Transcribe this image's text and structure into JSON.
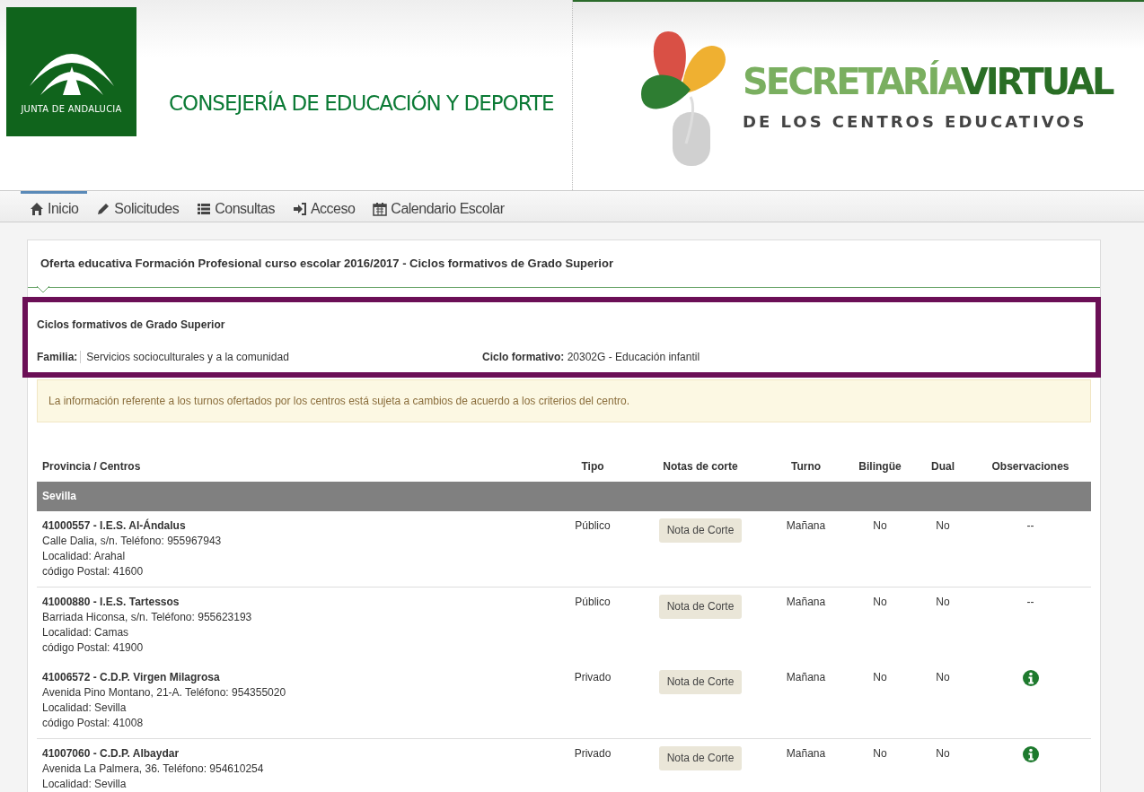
{
  "header": {
    "junta_logo_text": "JUNTA DE ANDALUCIA",
    "department": "CONSEJERÍA DE EDUCACIÓN Y DEPORTE",
    "brand_part_1": "SECRETARÍA",
    "brand_part_2": "VIRTUAL",
    "brand_subtitle": "DE LOS CENTROS EDUCATIVOS"
  },
  "nav": [
    {
      "label": "Inicio",
      "kind": "home",
      "selected": true
    },
    {
      "label": "Solicitudes",
      "kind": "pencil",
      "selected": false
    },
    {
      "label": "Consultas",
      "kind": "list",
      "selected": false
    },
    {
      "label": "Acceso",
      "kind": "login",
      "selected": false
    },
    {
      "label": "Calendario Escolar",
      "kind": "calendar",
      "selected": false
    }
  ],
  "panel_title": "Oferta educativa Formación Profesional curso escolar 2016/2017 - Ciclos formativos de Grado Superior",
  "selection": {
    "heading": "Ciclos formativos de Grado Superior",
    "familia_label": "Familia:",
    "familia_value": "Servicios socioculturales y a la comunidad",
    "ciclo_label": "Ciclo formativo:",
    "ciclo_value": "20302G - Educación infantil"
  },
  "notice": "La información referente a los turnos ofertados por los centros está sujeta a cambios de acuerdo a los criterios del centro.",
  "table": {
    "columns": [
      "Provincia / Centros",
      "Tipo",
      "Notas de corte",
      "Turno",
      "Bilingüe",
      "Dual",
      "Observaciones"
    ],
    "group": "Sevilla",
    "rows": [
      {
        "name": "41000557 - I.E.S. Al-Ándalus",
        "lines": [
          "Calle Dalia, s/n. Teléfono: 955967943",
          "Localidad: Arahal",
          "código Postal: 41600"
        ],
        "tipo": "Público",
        "button": "Nota de Corte",
        "turno": "Mañana",
        "bilingue": "No",
        "dual": "No",
        "kind": "text",
        "obs_text": "--"
      },
      {
        "name": "41000880 - I.E.S. Tartessos",
        "lines": [
          "Barriada Hiconsa, s/n. Teléfono: 955623193",
          "Localidad: Camas",
          "código Postal: 41900"
        ],
        "tipo": "Público",
        "button": "Nota de Corte",
        "turno": "Mañana",
        "bilingue": "No",
        "dual": "No",
        "kind": "text",
        "obs_text": "--"
      },
      {
        "name": "41006572 - C.D.P. Virgen Milagrosa",
        "lines": [
          "Avenida Pino Montano, 21-A. Teléfono: 954355020",
          "Localidad: Sevilla",
          "código Postal: 41008"
        ],
        "tipo": "Privado",
        "button": "Nota de Corte",
        "turno": "Mañana",
        "bilingue": "No",
        "dual": "No",
        "kind": "info"
      },
      {
        "name": "41007060 - C.D.P. Albaydar",
        "lines": [
          "Avenida La Palmera, 36. Teléfono: 954610254",
          "Localidad: Sevilla"
        ],
        "tipo": "Privado",
        "button": "Nota de Corte",
        "turno": "Mañana",
        "bilingue": "No",
        "dual": "No",
        "kind": "info"
      }
    ]
  }
}
